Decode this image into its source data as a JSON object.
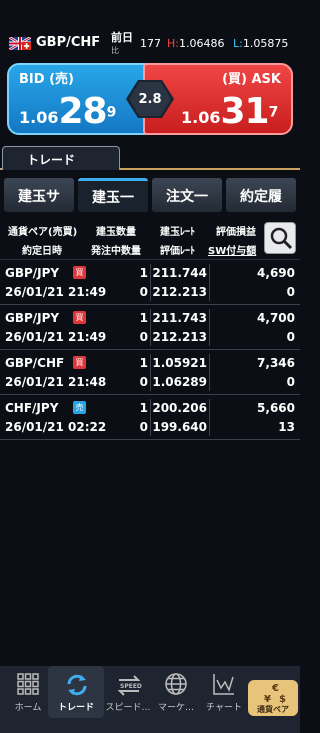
{
  "header": {
    "pair": "GBP/CHF",
    "prev_day_label": "前日",
    "prev_day_sub": "比",
    "count": "177",
    "high_key": "H:",
    "high_val": "1.06486",
    "low_key": "L:",
    "low_val": "1.05875"
  },
  "quote": {
    "bid_label": "BID (売)",
    "bid_prefix": "1.06",
    "bid_big": "28",
    "bid_sup": "9",
    "ask_label": "(買) ASK",
    "ask_prefix": "1.06",
    "ask_big": "31",
    "ask_sup": "7",
    "spread": "2.8"
  },
  "trade_tab": "トレード",
  "subtabs": [
    "建玉サ",
    "建玉一",
    "注文一",
    "約定履"
  ],
  "columns": {
    "pair_side": "通貨ペア(売買)",
    "contract_time": "約定日時",
    "position_qty": "建玉数量",
    "pending_qty": "発注中数量",
    "position_rate": "建玉ﾚｰﾄ",
    "eval_rate": "評価ﾚｰﾄ",
    "pnl": "評価損益",
    "sw": "SW付与額"
  },
  "positions": [
    {
      "pair": "GBP/JPY",
      "side": "買",
      "side_type": "buy",
      "datetime": "26/01/21 21:49",
      "qty": "1",
      "pending": "0",
      "rate": "211.744",
      "eval": "212.213",
      "pnl": "4,690",
      "sw": "0"
    },
    {
      "pair": "GBP/JPY",
      "side": "買",
      "side_type": "buy",
      "datetime": "26/01/21 21:49",
      "qty": "1",
      "pending": "0",
      "rate": "211.743",
      "eval": "212.213",
      "pnl": "4,700",
      "sw": "0"
    },
    {
      "pair": "GBP/CHF",
      "side": "買",
      "side_type": "buy",
      "datetime": "26/01/21 21:48",
      "qty": "1",
      "pending": "0",
      "rate": "1.05921",
      "eval": "1.06289",
      "pnl": "7,346",
      "sw": "0"
    },
    {
      "pair": "CHF/JPY",
      "side": "売",
      "side_type": "sell",
      "datetime": "26/01/21 02:22",
      "qty": "1",
      "pending": "0",
      "rate": "200.206",
      "eval": "199.640",
      "pnl": "5,660",
      "sw": "13"
    }
  ],
  "nav": [
    {
      "label": "ホーム",
      "icon": "grid-icon"
    },
    {
      "label": "トレード",
      "icon": "refresh-icon"
    },
    {
      "label": "スピード…",
      "icon": "speed-icon"
    },
    {
      "label": "マーケ…",
      "icon": "globe-icon"
    },
    {
      "label": "チャート",
      "icon": "chart-icon"
    }
  ],
  "fx_button_label": "通貨ペア",
  "colors": {
    "bid": "#1e90d8",
    "ask": "#e03a3a",
    "accent": "#3eaef0",
    "buy_badge": "#e0363a",
    "sell_badge": "#2aa3e0"
  }
}
